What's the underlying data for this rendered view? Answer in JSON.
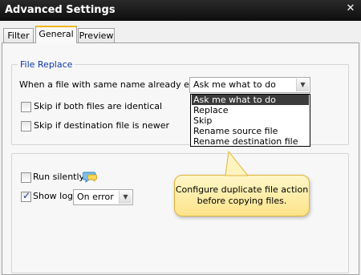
{
  "window": {
    "title": "Advanced Settings",
    "close_icon": "close-icon"
  },
  "tabs": [
    {
      "label": "Filter",
      "active": false
    },
    {
      "label": "General",
      "active": true
    },
    {
      "label": "Preview",
      "active": false
    }
  ],
  "file_replace": {
    "legend": "File Replace",
    "prompt": "When a file with same name already exists:",
    "selected": "Ask me what to do",
    "options": [
      "Ask me what to do",
      "Replace",
      "Skip",
      "Rename source file",
      "Rename destination file"
    ],
    "skip_identical": {
      "label": "Skip if both files are identical",
      "checked": false
    },
    "skip_newer": {
      "label": "Skip if destination file is newer",
      "checked": false
    }
  },
  "options": {
    "run_silently": {
      "label": "Run silently",
      "checked": false
    },
    "show_log": {
      "label": "Show log",
      "checked": true
    },
    "log_mode": "On error"
  },
  "tooltip": {
    "line1": "Configure duplicate file action",
    "line2": "before copying files."
  },
  "colors": {
    "accent_tab": "#f1b51d",
    "legend_blue": "#0c37a5",
    "tooltip_bg": "#fde38a",
    "selection_bg": "#3b3b3b"
  }
}
